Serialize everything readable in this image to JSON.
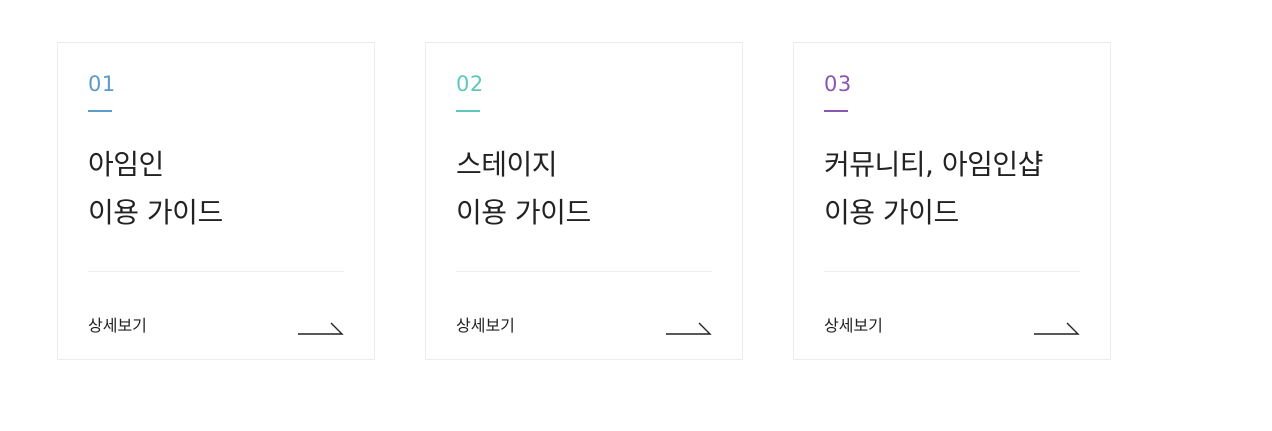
{
  "cards": [
    {
      "number": "01",
      "accent_color": "#5b9bc9",
      "title_line1": "아임인",
      "title_line2": "이용 가이드",
      "more_label": "상세보기",
      "arrow_icon": "arrow-right-icon"
    },
    {
      "number": "02",
      "accent_color": "#5ec8bd",
      "title_line1": "스테이지",
      "title_line2": "이용 가이드",
      "more_label": "상세보기",
      "arrow_icon": "arrow-right-icon"
    },
    {
      "number": "03",
      "accent_color": "#8a56b4",
      "title_line1": "커뮤니티, 아임인샵",
      "title_line2": "이용 가이드",
      "more_label": "상세보기",
      "arrow_icon": "arrow-right-icon"
    }
  ]
}
